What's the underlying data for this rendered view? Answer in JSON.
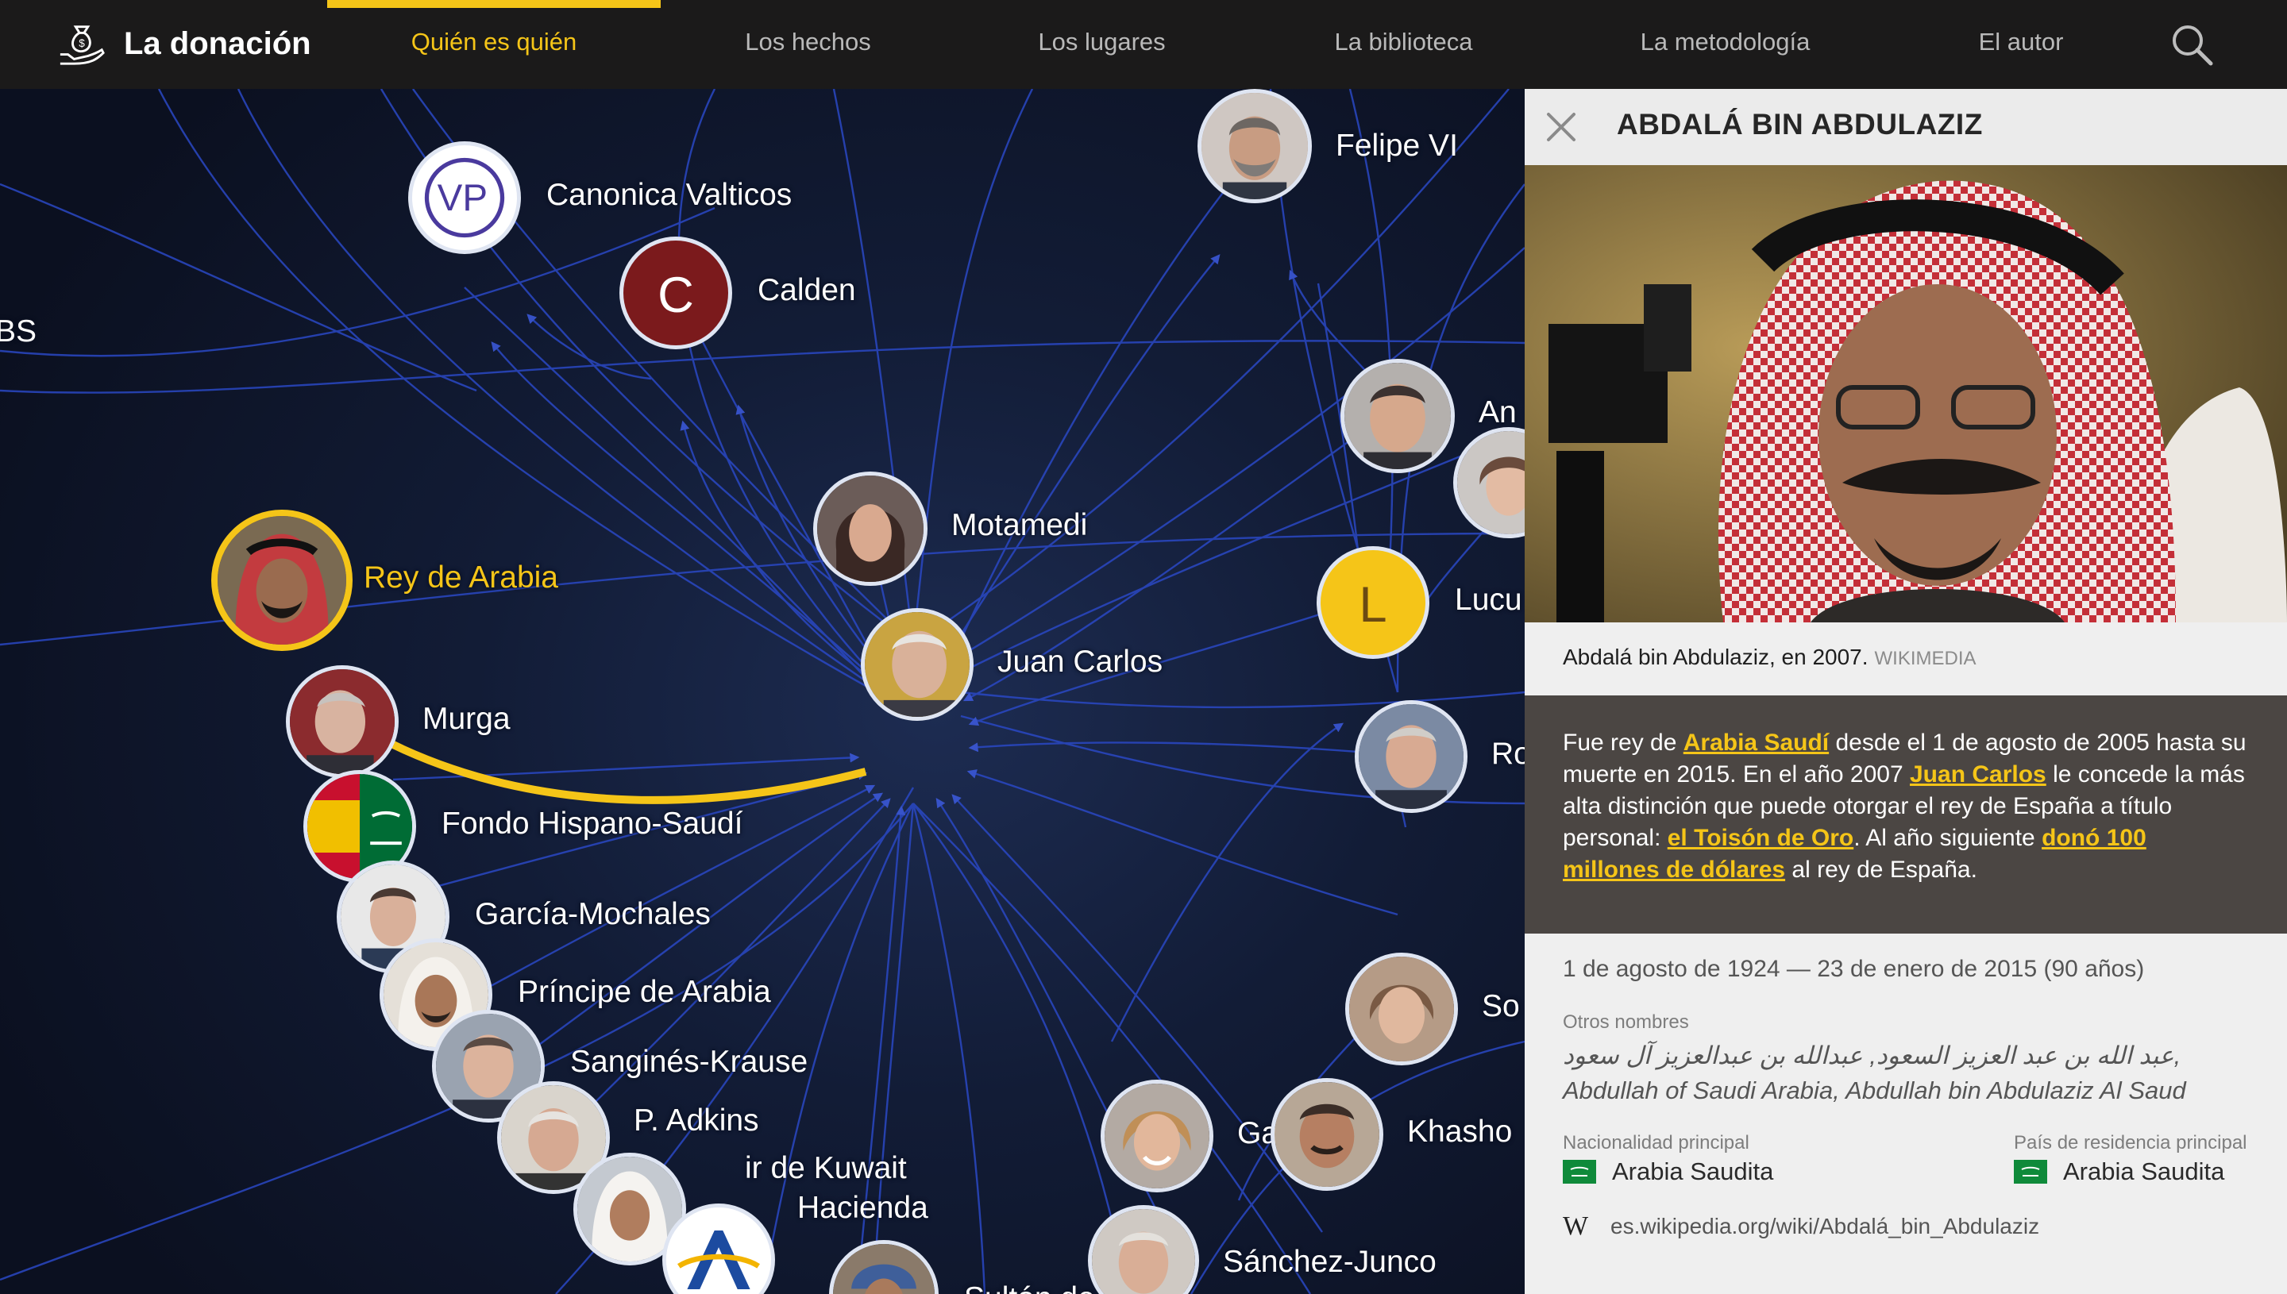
{
  "brand": {
    "name": "La donación",
    "icon": "money-bag-hand-icon"
  },
  "nav": {
    "items": [
      {
        "label": "Quién es quién",
        "active": true
      },
      {
        "label": "Los hechos",
        "active": false
      },
      {
        "label": "Los lugares",
        "active": false
      },
      {
        "label": "La biblioteca",
        "active": false
      },
      {
        "label": "La metodología",
        "active": false
      },
      {
        "label": "El autor",
        "active": false
      }
    ],
    "search_icon": "search-icon"
  },
  "graph": {
    "nodes": [
      {
        "label": "Canonica Valticos",
        "kind": "logo",
        "text": "VP"
      },
      {
        "label": "Calden",
        "kind": "letter",
        "text": "C",
        "color": "#7b1a1c"
      },
      {
        "label": "BS",
        "kind": "offscreen"
      },
      {
        "label": "Felipe VI",
        "kind": "person"
      },
      {
        "label": "An",
        "kind": "person"
      },
      {
        "label": "Motamedi",
        "kind": "person"
      },
      {
        "label": "Rey de Arabia",
        "kind": "person",
        "selected": true
      },
      {
        "label": "Juan Carlos",
        "kind": "person"
      },
      {
        "label": "Lucu",
        "kind": "letter",
        "text": "L",
        "color": "#f5c518"
      },
      {
        "label": "Murga",
        "kind": "person"
      },
      {
        "label": "Fondo Hispano-Saudí",
        "kind": "flags"
      },
      {
        "label": "Ro",
        "kind": "person"
      },
      {
        "label": "García-Mochales",
        "kind": "person"
      },
      {
        "label": "Príncipe de Arabia",
        "kind": "person"
      },
      {
        "label": "So",
        "kind": "person"
      },
      {
        "label": "Sanginés-Krause",
        "kind": "person"
      },
      {
        "label": "P. Adkins",
        "kind": "person"
      },
      {
        "label": "ir de Kuwait",
        "kind": "person"
      },
      {
        "label": "Hacienda",
        "kind": "logo"
      },
      {
        "label": "Sultán de Omán",
        "kind": "person"
      },
      {
        "label": "Gayá",
        "kind": "person"
      },
      {
        "label": "Khasho",
        "kind": "person"
      },
      {
        "label": "Sánchez-Junco",
        "kind": "person"
      }
    ],
    "highlight_edge_color": "#f5c518",
    "edge_color": "#2a48c4"
  },
  "panel": {
    "close_icon": "close-icon",
    "title": "ABDALÁ BIN ABDULAZIZ",
    "caption": "Abdalá bin Abdulaziz, en 2007.",
    "credit": "WIKIMEDIA",
    "bio": {
      "t1": "Fue rey de ",
      "link1": "Arabia Saudí",
      "t2": " desde el 1 de agosto de 2005 hasta su muerte en 2015. En el año 2007 ",
      "link2": "Juan Carlos",
      "t3": " le concede la más alta distinción que puede otorgar el rey de España a título personal: ",
      "link3": "el Toisón de Oro",
      "t4": ". Al año siguiente ",
      "link4": "donó 100 millones de dólares",
      "t5": " al rey de España."
    },
    "dates": "1 de agosto de 1924 — 23 de enero de 2015 (90 años)",
    "other_names_label": "Otros nombres",
    "other_names": "عبد الله بن عبد العزيز السعود, عبدالله بن عبدالعزيز آل سعود, Abdullah of Saudi Arabia, Abdullah bin Abdulaziz Al Saud",
    "nationality_label": "Nacionalidad principal",
    "nationality": "Arabia Saudita",
    "residence_label": "País de residencia principal",
    "residence": "Arabia Saudita",
    "wiki_icon": "wikipedia-icon",
    "wiki_glyph": "W",
    "wiki_url": "es.wikipedia.org/wiki/Abdalá_bin_Abdulaziz"
  }
}
